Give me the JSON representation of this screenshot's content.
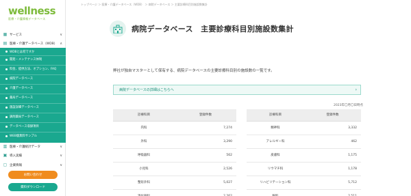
{
  "brand": {
    "logo": "wellness",
    "tagline": "医療・介護情報データベース"
  },
  "sidebar": {
    "top_items": [
      {
        "label": "サービス",
        "icon": "grid-icon",
        "chevron": "∨"
      },
      {
        "label": "医療・介護データベース（WDB）",
        "icon": "db-icon",
        "chevron": "∧"
      }
    ],
    "green_items": [
      {
        "label": "WDBとは何ですか"
      },
      {
        "label": "開発・メンテナンス体制"
      },
      {
        "label": "料金、提供方法、オプション、FAQ"
      },
      {
        "label": "病院データベース"
      },
      {
        "label": "介護データベース"
      },
      {
        "label": "薬局データベース"
      },
      {
        "label": "施設詳細データベース"
      },
      {
        "label": "調剤薬局データベース"
      },
      {
        "label": "データベース収録項目"
      },
      {
        "label": "WEB版無料サンプル"
      }
    ],
    "bottom_items": [
      {
        "label": "医療・介護統計データ",
        "icon": "chart-icon",
        "chevron": "∨"
      },
      {
        "label": "導入実績",
        "icon": "building-icon",
        "chevron": "∨"
      },
      {
        "label": "企業情報",
        "icon": "company-icon",
        "chevron": "∨"
      }
    ],
    "buttons": {
      "contact": "お問い合わせ",
      "download": "資料ダウンロード"
    }
  },
  "main": {
    "breadcrumb": "トップページ ＞ 医療・介護データベース（WDB） ＞ 病院データベース ＞ 主要診療科目別施設数集計",
    "title": "病院データベース　主要診療科目別施設数集計",
    "description": "弊社が独自マスターとして保有する、病院データベースの主要診療科目別の施設数の一覧です。",
    "link_text": "病院データベースの詳細はこちらへ",
    "note": "2023年〇月〇日時点",
    "table_headers": {
      "subject": "診療科目",
      "count": "登録件数"
    },
    "left_rows": [
      {
        "name": "内科",
        "count": "7,274"
      },
      {
        "name": "外科",
        "count": "3,290"
      },
      {
        "name": "呼吸器科",
        "count": "562"
      },
      {
        "name": "小児科",
        "count": "2,526"
      },
      {
        "name": "整形外科",
        "count": "5,027"
      },
      {
        "name": "消化器科",
        "count": "2,262"
      }
    ],
    "right_rows": [
      {
        "name": "精神科",
        "count": "3,332"
      },
      {
        "name": "アレルギー科",
        "count": "462"
      },
      {
        "name": "皮膚科",
        "count": "1,175"
      },
      {
        "name": "リウマチ科",
        "count": "1,178"
      },
      {
        "name": "リハビリテーション科",
        "count": "5,712"
      },
      {
        "name": "眼科",
        "count": "2,511"
      }
    ]
  },
  "colors": {
    "accent": "#1aa88f",
    "logo": "#7dbb3b",
    "cta": "#f08c1e"
  }
}
